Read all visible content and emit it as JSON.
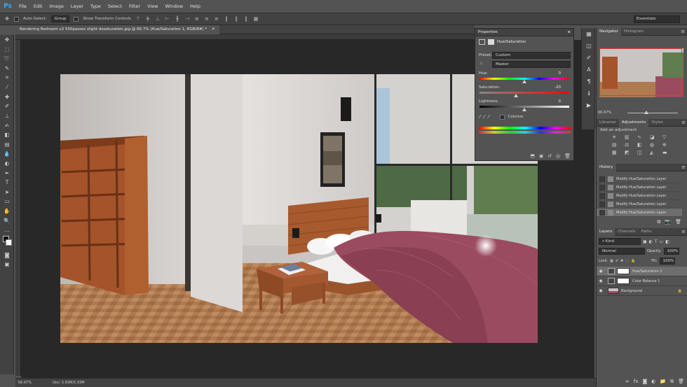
{
  "app": {
    "logo": "Ps",
    "menu": [
      "File",
      "Edit",
      "Image",
      "Layer",
      "Type",
      "Select",
      "Filter",
      "View",
      "Window",
      "Help"
    ]
  },
  "options_bar": {
    "auto_select_label": "Auto-Select:",
    "auto_select_value": "Group",
    "show_transform_label": "Show Transform Controls",
    "workspace": "Essentials"
  },
  "document": {
    "tab_title": "Rendering Bedroom v2 500passes slight desaturation.jpg @ 66.7% (Hue/Saturation 1, RGB/8#) *",
    "zoom": "66.67%",
    "doc_info": "Doc: 5.93M/5.93M"
  },
  "properties": {
    "tab_label": "Properties",
    "panel_title": "Hue/Saturation",
    "preset_label": "Preset:",
    "preset_value": "Custom",
    "channel_value": "Master",
    "hue_label": "Hue:",
    "hue_value": "0",
    "saturation_label": "Saturation:",
    "saturation_value": "-20",
    "lightness_label": "Lightness:",
    "lightness_value": "0",
    "colorize_label": "Colorize"
  },
  "navigator": {
    "tabs": [
      "Navigator",
      "Histogram"
    ],
    "zoom": "66.67%"
  },
  "adjustments": {
    "tabs": [
      "Libraries",
      "Adjustments",
      "Styles"
    ],
    "hint": "Add an adjustment"
  },
  "history": {
    "tab_label": "History",
    "items": [
      "Modify Hue/Saturation Layer",
      "Modify Hue/Saturation Layer",
      "Modify Hue/Saturation Layer",
      "Modify Hue/Saturation Layer",
      "Modify Hue/Saturation Layer"
    ]
  },
  "layers": {
    "tabs": [
      "Layers",
      "Channels",
      "Paths"
    ],
    "kind_label": "Kind",
    "blend_mode": "Normal",
    "opacity_label": "Opacity:",
    "opacity_value": "100%",
    "lock_label": "Lock:",
    "fill_label": "Fill:",
    "fill_value": "100%",
    "items": [
      {
        "name": "Hue/Saturation 1"
      },
      {
        "name": "Color Balance 1"
      },
      {
        "name": "Background"
      }
    ]
  },
  "colors": {
    "accent": "#31a8ff",
    "panel_bg": "#535353",
    "canvas_bg": "#282828"
  }
}
